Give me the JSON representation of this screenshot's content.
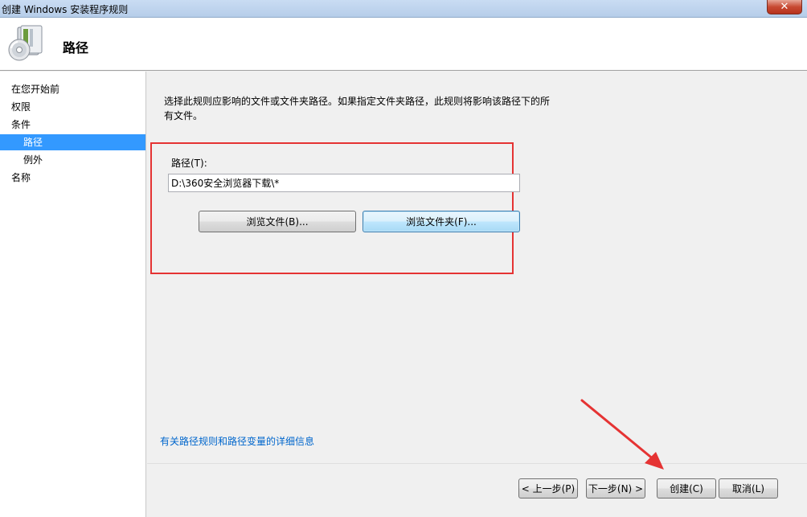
{
  "window": {
    "title": "创建 Windows 安装程序规则",
    "close_symbol": "✕"
  },
  "header": {
    "title": "路径",
    "icon": "installer-package-icon"
  },
  "nav": {
    "items": [
      {
        "label": "在您开始前",
        "indent": false,
        "selected": false
      },
      {
        "label": "权限",
        "indent": false,
        "selected": false
      },
      {
        "label": "条件",
        "indent": false,
        "selected": false
      },
      {
        "label": "路径",
        "indent": true,
        "selected": true
      },
      {
        "label": "例外",
        "indent": true,
        "selected": false
      },
      {
        "label": "名称",
        "indent": false,
        "selected": false
      }
    ]
  },
  "main": {
    "description_line1": "选择此规则应影响的文件或文件夹路径。如果指定文件夹路径，此规则将影响该路径下的所",
    "description_line2": "有文件。",
    "path_label": "路径(T):",
    "path_value": "D:\\360安全浏览器下载\\*",
    "browse_files_label": "浏览文件(B)...",
    "browse_folders_label": "浏览文件夹(F)...",
    "help_link": "有关路径规则和路径变量的详细信息"
  },
  "footer": {
    "prev_label": "< 上一步(P)",
    "next_label": "下一步(N) >",
    "create_label": "创建(C)",
    "cancel_label": "取消(L)"
  },
  "colors": {
    "selection": "#3399ff",
    "annotation_red": "#e53333",
    "link": "#0066cc"
  }
}
